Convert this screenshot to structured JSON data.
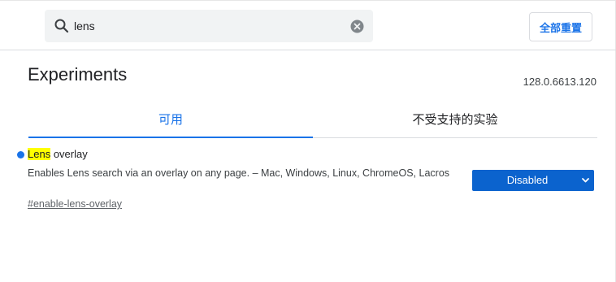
{
  "search": {
    "value": "lens",
    "icon": "search-icon",
    "clear_icon": "clear-icon"
  },
  "header": {
    "reset_label": "全部重置"
  },
  "page": {
    "title": "Experiments",
    "version": "128.0.6613.120"
  },
  "tabs": [
    {
      "label": "可用",
      "active": true
    },
    {
      "label": "不受支持的实验",
      "active": false
    }
  ],
  "experiment": {
    "title_highlight": "Lens",
    "title_rest": " overlay",
    "description": "Enables Lens search via an overlay on any page. – Mac, Windows, Linux, ChromeOS, Lacros",
    "link": "#enable-lens-overlay",
    "status": "Disabled"
  },
  "colors": {
    "accent": "#1a73e8",
    "select_bg": "#0b63ce",
    "highlight": "#ffff00"
  }
}
